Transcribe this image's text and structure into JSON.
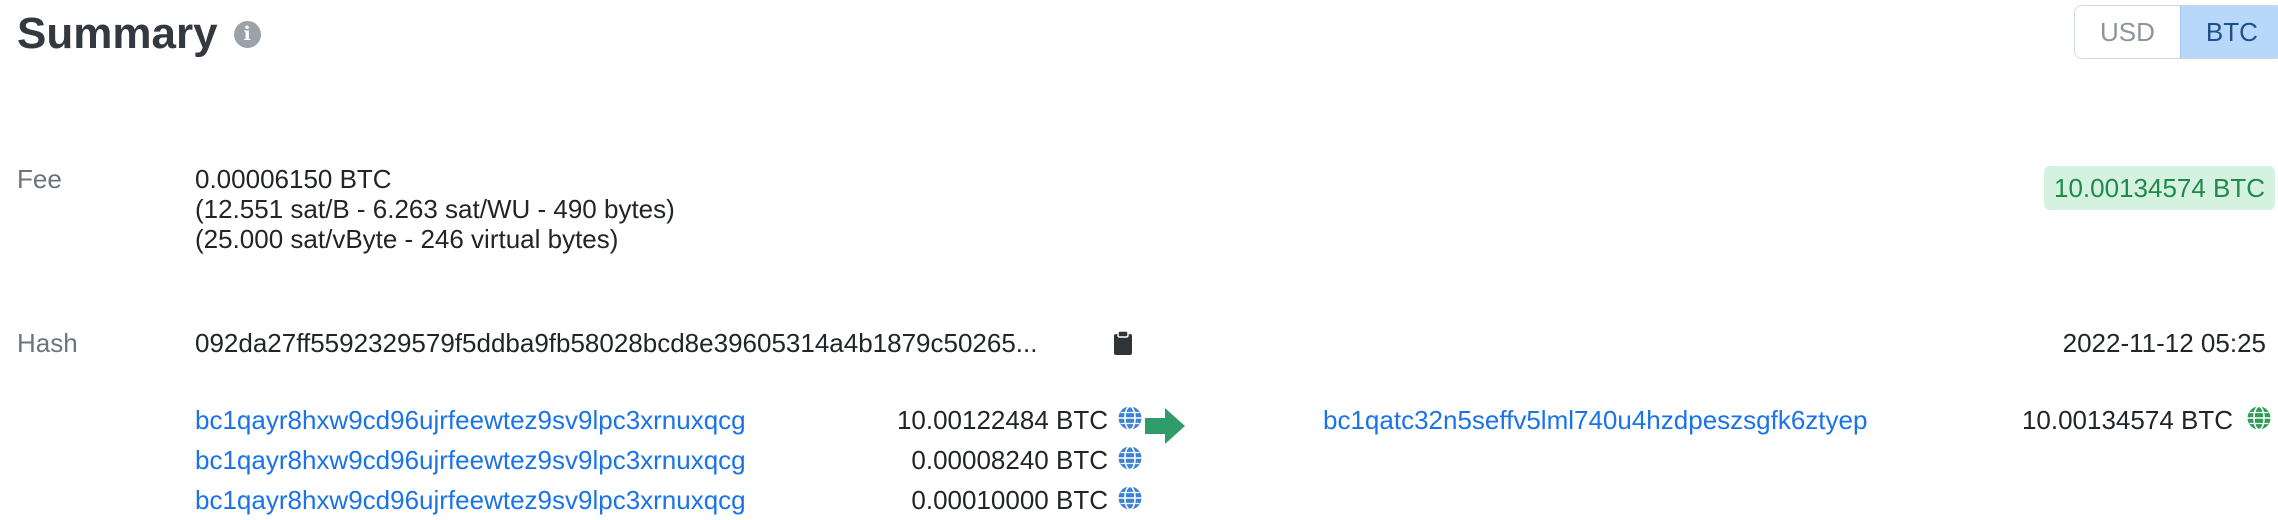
{
  "header": {
    "title": "Summary",
    "info_icon": "info-icon",
    "currency_toggle": {
      "options": [
        "USD",
        "BTC"
      ],
      "selected": "BTC"
    }
  },
  "fee": {
    "label": "Fee",
    "amount": "0.00006150 BTC",
    "rate_detail": "(12.551 sat/B - 6.263 sat/WU - 490 bytes)",
    "vbyte_detail": "(25.000 sat/vByte - 246 virtual bytes)",
    "total_badge": "10.00134574 BTC"
  },
  "hash": {
    "label": "Hash",
    "value": "092da27ff5592329579f5ddba9fb58028bcd8e39605314a4b1879c50265...",
    "copy_icon": "clipboard-icon",
    "timestamp": "2022-11-12 05:25"
  },
  "inputs": [
    {
      "address": "bc1qayr8hxw9cd96ujrfeewtez9sv9lpc3xrnuxqcg",
      "amount": "10.00122484 BTC"
    },
    {
      "address": "bc1qayr8hxw9cd96ujrfeewtez9sv9lpc3xrnuxqcg",
      "amount": "0.00008240 BTC"
    },
    {
      "address": "bc1qayr8hxw9cd96ujrfeewtez9sv9lpc3xrnuxqcg",
      "amount": "0.00010000 BTC"
    }
  ],
  "outputs": [
    {
      "address": "bc1qatc32n5seffv5lml740u4hzdpeszsgfk6ztyep",
      "amount": "10.00134574 BTC"
    }
  ],
  "colors": {
    "link": "#1a73e8",
    "input_globe": "#3b82d6",
    "output_globe": "#2e9d55",
    "arrow": "#2e9d6a",
    "badge_bg": "#d4f2df",
    "badge_text": "#1f8a4c"
  }
}
